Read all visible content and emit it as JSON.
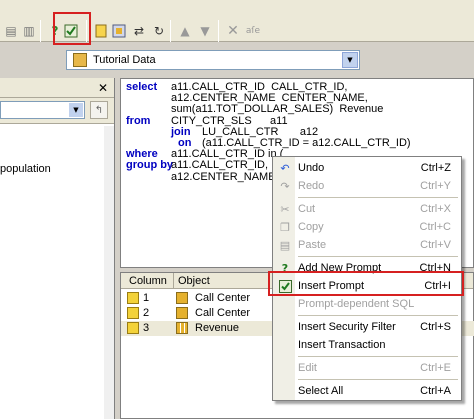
{
  "toolbar": {
    "icons": [
      "copy-icon",
      "paste-icon",
      "help-icon",
      "insert-prompt-icon",
      "document-icon",
      "project-icon",
      "refresh-icon",
      "up-arrow-icon",
      "down-arrow-icon",
      "delete-icon",
      "text-format-icon"
    ],
    "highlight_color": "#d62020"
  },
  "project": {
    "selected": "Tutorial Data"
  },
  "left_panel": {
    "item": "population"
  },
  "sql": {
    "lines": [
      {
        "kw": "select",
        "text": "a11.CALL_CTR_ID  CALL_CTR_ID,"
      },
      {
        "kw": "",
        "text": "a12.CENTER_NAME  CENTER_NAME,"
      },
      {
        "kw": "",
        "text": "sum(a11.TOT_DOLLAR_SALES)  Revenue"
      },
      {
        "kw": "from",
        "text": "CITY_CTR_SLS      a11"
      },
      {
        "kw": "",
        "pre_kw": "join",
        "text": "LU_CALL_CTR       a12"
      },
      {
        "kw": "",
        "pre_kw": "on",
        "text": "(a11.CALL_CTR_ID = a12.CALL_CTR_ID)"
      },
      {
        "kw": "where",
        "text": "a11.CALL_CTR_ID in ("
      },
      {
        "kw": "group by",
        "text": "a11.CALL_CTR_ID,"
      },
      {
        "kw": "",
        "text": "a12.CENTER_NAME"
      }
    ]
  },
  "grid": {
    "columns": [
      "Column",
      "Object"
    ],
    "rows": [
      {
        "num": "1",
        "object": "Call Center"
      },
      {
        "num": "2",
        "object": "Call Center"
      },
      {
        "num": "3",
        "object": "Revenue"
      }
    ]
  },
  "context_menu": {
    "items": [
      {
        "icon": "undo-icon",
        "label": "Undo",
        "key": "Ctrl+Z",
        "disabled": false
      },
      {
        "icon": "redo-icon",
        "label": "Redo",
        "key": "Ctrl+Y",
        "disabled": true
      },
      {
        "icon": "cut-icon",
        "label": "Cut",
        "key": "Ctrl+X",
        "disabled": true
      },
      {
        "icon": "copy-icon",
        "label": "Copy",
        "key": "Ctrl+C",
        "disabled": true
      },
      {
        "icon": "paste-icon",
        "label": "Paste",
        "key": "Ctrl+V",
        "disabled": true
      },
      {
        "icon": "add-prompt-icon",
        "label": "Add New Prompt",
        "key": "Ctrl+N",
        "disabled": false
      },
      {
        "icon": "insert-prompt-icon",
        "label": "Insert Prompt",
        "key": "Ctrl+I",
        "disabled": false
      },
      {
        "icon": "",
        "label": "Prompt-dependent SQL",
        "key": "",
        "disabled": true
      },
      {
        "icon": "",
        "label": "Insert Security Filter",
        "key": "Ctrl+S",
        "disabled": false
      },
      {
        "icon": "",
        "label": "Insert Transaction",
        "key": "",
        "disabled": false
      },
      {
        "icon": "",
        "label": "Edit",
        "key": "Ctrl+E",
        "disabled": true
      },
      {
        "icon": "",
        "label": "Select All",
        "key": "Ctrl+A",
        "disabled": false
      }
    ]
  }
}
